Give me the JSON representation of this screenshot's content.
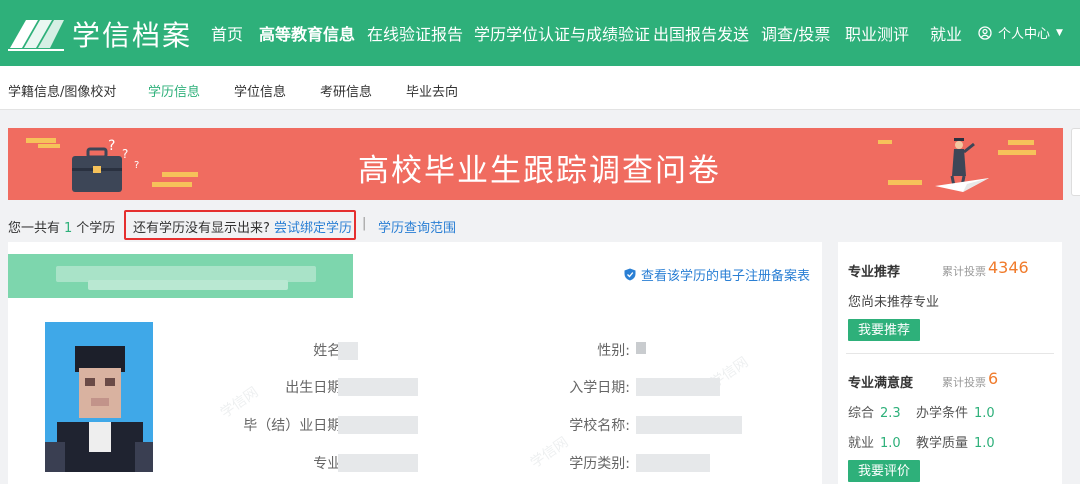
{
  "brand": {
    "name": "学信档案"
  },
  "nav": {
    "items": [
      {
        "label": "首页"
      },
      {
        "label": "高等教育信息"
      },
      {
        "label": "在线验证报告"
      },
      {
        "label": "学历学位认证与成绩验证"
      },
      {
        "label": "出国报告发送"
      },
      {
        "label": "调查/投票"
      },
      {
        "label": "职业测评"
      },
      {
        "label": "就业"
      }
    ],
    "user_label": "个人中心"
  },
  "subnav": {
    "items": [
      {
        "label": "学籍信息/图像校对"
      },
      {
        "label": "学历信息"
      },
      {
        "label": "学位信息"
      },
      {
        "label": "考研信息"
      },
      {
        "label": "毕业去向"
      }
    ]
  },
  "banner": {
    "title": "高校毕业生跟踪调查问卷"
  },
  "summary": {
    "prefix": "您一共有",
    "count": "1",
    "suffix": "个学历",
    "question": "还有学历没有显示出来?",
    "bind_link": "尝试绑定学历",
    "separator": "|",
    "scope_link": "学历查询范围"
  },
  "record": {
    "reg_link": "查看该学历的电子注册备案表",
    "fields": {
      "name": "姓名:",
      "gender": "性别:",
      "birth": "出生日期:",
      "enroll": "入学日期:",
      "graduate": "毕（结）业日期:",
      "school": "学校名称:",
      "major": "专业:",
      "edu_type": "学历类别:"
    },
    "watermark": "学信网"
  },
  "panel": {
    "recommend": {
      "title": "专业推荐",
      "votes_label": "累计投票",
      "votes": "4346",
      "status": "您尚未推荐专业",
      "button": "我要推荐"
    },
    "satisfaction": {
      "title": "专业满意度",
      "votes_label": "累计投票",
      "votes": "6",
      "scores": [
        {
          "label": "综合",
          "value": "2.3"
        },
        {
          "label": "办学条件",
          "value": "1.0"
        },
        {
          "label": "就业",
          "value": "1.0"
        },
        {
          "label": "教学质量",
          "value": "1.0"
        }
      ],
      "button": "我要评价"
    }
  },
  "colors": {
    "brand_green": "#2eb07a",
    "banner_red": "#f06c60",
    "link_blue": "#2a7fd4",
    "highlight_red": "#e52f2f",
    "vote_orange": "#f07b2c"
  },
  "icons": [
    "logo-book-icon",
    "user-circle-icon",
    "caret-down-icon",
    "shield-icon",
    "briefcase-icon",
    "question-mark-icon",
    "graduate-icon",
    "paper-plane-icon"
  ]
}
